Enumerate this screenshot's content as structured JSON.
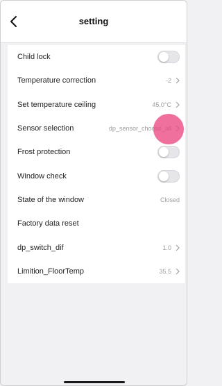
{
  "header": {
    "title": "setting",
    "back_icon": "chevron-left-icon"
  },
  "rows": [
    {
      "id": "child-lock",
      "label": "Child lock",
      "type": "toggle",
      "on": false
    },
    {
      "id": "temperature-correction",
      "label": "Temperature correction",
      "type": "value",
      "value": "-2"
    },
    {
      "id": "set-temperature-ceiling",
      "label": "Set temperature ceiling",
      "type": "value",
      "value": "45.0°C"
    },
    {
      "id": "sensor-selection",
      "label": "Sensor selection",
      "type": "value",
      "value": "dp_sensor_choose_all"
    },
    {
      "id": "frost-protection",
      "label": "Frost protection",
      "type": "toggle",
      "on": false
    },
    {
      "id": "window-check",
      "label": "Window check",
      "type": "toggle",
      "on": false
    },
    {
      "id": "state-of-the-window",
      "label": "State of the window",
      "type": "text",
      "value": "Closed"
    },
    {
      "id": "factory-data-reset",
      "label": "Factory data reset",
      "type": "action"
    },
    {
      "id": "dp-switch-dif",
      "label": "dp_switch_dif",
      "type": "value",
      "value": "1.0"
    },
    {
      "id": "limition-floortemp",
      "label": "Limition_FloorTemp",
      "type": "value",
      "value": "35.5"
    }
  ],
  "colors": {
    "background": "#f1f1f3",
    "card": "#ffffff",
    "toggle_off": "#e6e6ea",
    "value_text": "#9c9ca2",
    "touch_indicator": "#ec4882"
  }
}
